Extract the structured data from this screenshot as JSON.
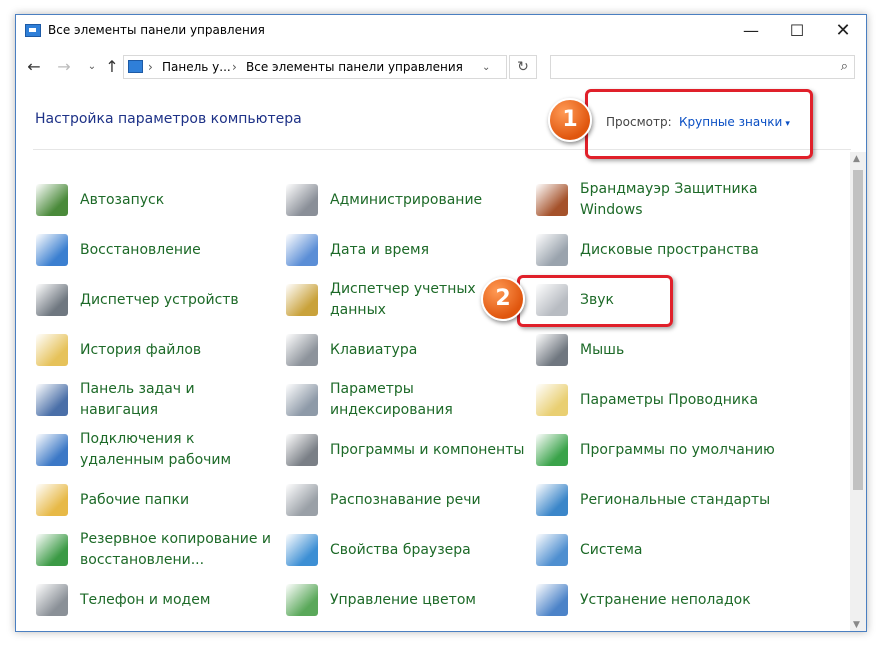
{
  "window": {
    "title": "Все элементы панели управления",
    "controls": {
      "minimize": "—",
      "maximize": "☐",
      "close": "✕"
    }
  },
  "nav": {
    "back": "←",
    "forward": "→",
    "history": "⌄",
    "up": "↑",
    "breadcrumb_sep": "›",
    "breadcrumb": [
      "Панель у...",
      "Все элементы панели управления"
    ],
    "address_dropdown": "⌄",
    "refresh": "↻",
    "search_value": "",
    "search_placeholder": "",
    "search_icon": "⌕"
  },
  "header": {
    "title": "Настройка параметров компьютера",
    "view_label": "Просмотр:",
    "view_value": "Крупные значки",
    "view_caret": "▾"
  },
  "items": [
    {
      "label": "Автозапуск",
      "icon": "autoplay-icon",
      "color": "#4a8a3a"
    },
    {
      "label": "Администрирование",
      "icon": "admin-tools-icon",
      "color": "#8a8f98"
    },
    {
      "label": "Брандмауэр Защитника Windows",
      "icon": "firewall-icon",
      "color": "#a5522b"
    },
    {
      "label": "Восстановление",
      "icon": "recovery-icon",
      "color": "#3b7fd0"
    },
    {
      "label": "Дата и время",
      "icon": "clock-icon",
      "color": "#5b8ed6"
    },
    {
      "label": "Дисковые пространства",
      "icon": "storage-spaces-icon",
      "color": "#9aa3ad"
    },
    {
      "label": "Диспетчер устройств",
      "icon": "device-manager-icon",
      "color": "#6f7780"
    },
    {
      "label": "Диспетчер учетных данных",
      "icon": "credential-manager-icon",
      "color": "#c9a23b"
    },
    {
      "label": "Звук",
      "icon": "speaker-icon",
      "color": "#b8bcc2"
    },
    {
      "label": "История файлов",
      "icon": "file-history-icon",
      "color": "#e6c25a"
    },
    {
      "label": "Клавиатура",
      "icon": "keyboard-icon",
      "color": "#8d939b"
    },
    {
      "label": "Мышь",
      "icon": "mouse-icon",
      "color": "#707780"
    },
    {
      "label": "Панель задач и навигация",
      "icon": "taskbar-icon",
      "color": "#4a6fa8"
    },
    {
      "label": "Параметры индексирования",
      "icon": "indexing-icon",
      "color": "#8e9aa8"
    },
    {
      "label": "Параметры Проводника",
      "icon": "folder-options-icon",
      "color": "#e9cf72"
    },
    {
      "label": "Подключения к удаленным рабочим",
      "icon": "remote-connections-icon",
      "color": "#3c78c6"
    },
    {
      "label": "Программы и компоненты",
      "icon": "programs-icon",
      "color": "#7a7f86"
    },
    {
      "label": "Программы по умолчанию",
      "icon": "default-programs-icon",
      "color": "#3aa34a"
    },
    {
      "label": "Рабочие папки",
      "icon": "work-folders-icon",
      "color": "#e7b947"
    },
    {
      "label": "Распознавание речи",
      "icon": "microphone-icon",
      "color": "#9aa0a7"
    },
    {
      "label": "Региональные стандарты",
      "icon": "region-icon",
      "color": "#3b86c9"
    },
    {
      "label": "Резервное копирование и восстановлени...",
      "icon": "backup-icon",
      "color": "#3b9a45"
    },
    {
      "label": "Свойства браузера",
      "icon": "internet-options-icon",
      "color": "#3d8fd4"
    },
    {
      "label": "Система",
      "icon": "system-icon",
      "color": "#4f8fd0"
    },
    {
      "label": "Телефон и модем",
      "icon": "phone-modem-icon",
      "color": "#8a9097"
    },
    {
      "label": "Управление цветом",
      "icon": "color-management-icon",
      "color": "#5aa85a"
    },
    {
      "label": "Устранение неполадок",
      "icon": "troubleshooting-icon",
      "color": "#4c83c8"
    }
  ],
  "callouts": [
    "1",
    "2"
  ],
  "scrollbar": {
    "up": "▲",
    "down": "▼"
  }
}
